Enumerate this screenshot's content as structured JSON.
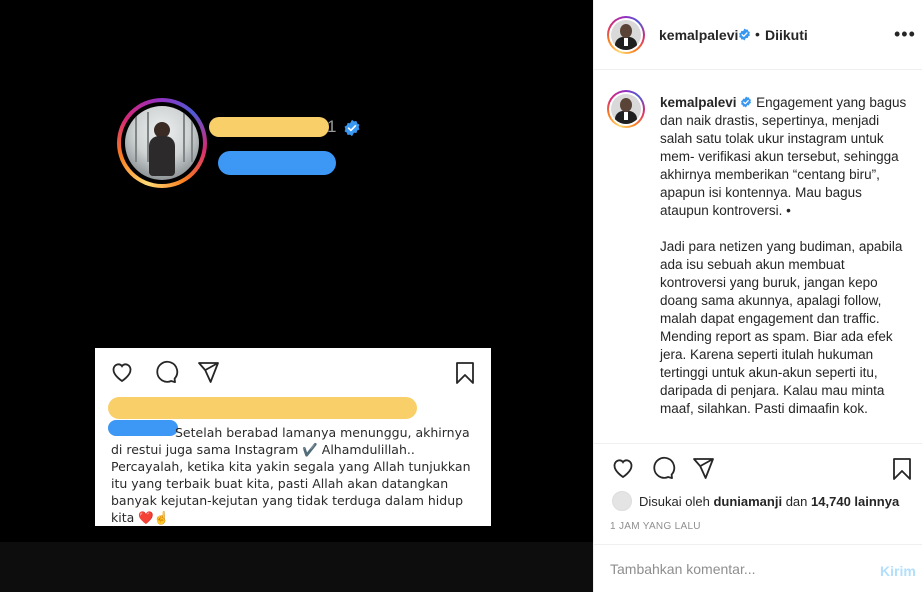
{
  "media": {
    "screenshot_name_suffix": "1",
    "card_caption_lines": [
      "Setelah berabad lamanya menunggu, akhirnya",
      "di restui juga sama Instagram ✔️ Alhamdulillah..",
      "Percayalah, ketika kita yakin segala yang Allah tunjukkan",
      "itu yang terbaik buat kita, pasti Allah akan datangkan",
      "banyak kejutan-kejutan yang tidak terduga dalam hidup",
      "kita ❤️☝️"
    ]
  },
  "header": {
    "username": "kemalpalevi",
    "separator": "•",
    "follow_status": "Diikuti",
    "more": "•••"
  },
  "caption": {
    "username": "kemalpalevi",
    "paragraph1": "Engagement yang bagus dan naik drastis, sepertinya, menjadi salah satu tolak ukur instagram untuk mem- verifikasi akun tersebut, sehingga akhirnya memberikan “centang biru”, apapun isi kontennya. Mau bagus ataupun kontroversi. •",
    "paragraph2": "Jadi para netizen yang budiman, apabila ada isu sebuah akun membuat kontroversi yang buruk, jangan kepo doang sama akunnya, apalagi follow, malah dapat engagement dan traffic. Mending report as spam. Biar ada efek jera. Karena seperti itulah hukuman tertinggi untuk akun-akun seperti itu, daripada di penjara. Kalau mau minta maaf, silahkan. Pasti dimaafin kok."
  },
  "likes": {
    "prefix": "Disukai oleh",
    "user": "duniamanji",
    "connector": "dan",
    "others": "14,740 lainnya"
  },
  "time": "1 JAM YANG LALU",
  "comment": {
    "placeholder": "Tambahkan komentar...",
    "post_label": "Kirim"
  },
  "icons": {
    "like": "heart-icon",
    "comment": "comment-icon",
    "share": "send-icon",
    "save": "bookmark-icon",
    "verified": "verified-badge-icon"
  },
  "colors": {
    "verified_blue": "#3897f0",
    "post_button_disabled": "#b2dffc",
    "highlight_yellow": "#f9cf6a",
    "highlight_blue": "#3d97f5"
  }
}
